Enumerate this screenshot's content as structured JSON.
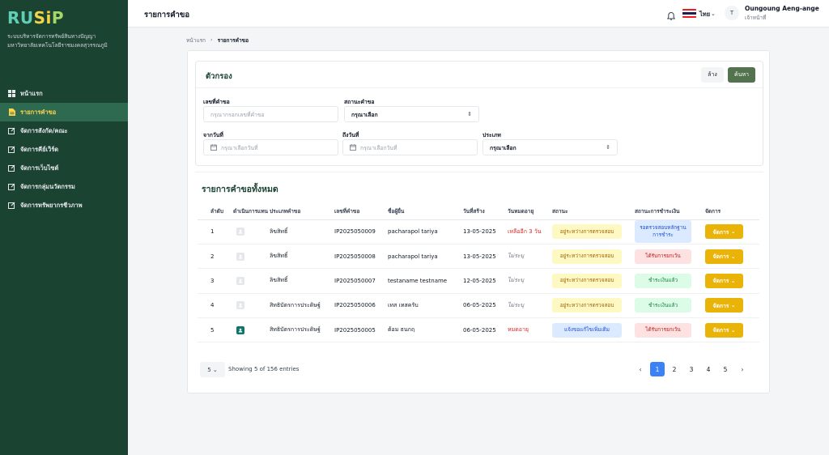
{
  "brand": {
    "logo": "RUSiP",
    "org_line1": "ระบบบริหารจัดการทรัพย์สินทางปัญญา",
    "org_line2": "มหาวิทยาลัยเทคโนโลยีราชมงคลสุวรรณภูมิ"
  },
  "sidebar": {
    "items": [
      {
        "label": "หน้าแรก",
        "icon": "grid-icon",
        "active": false
      },
      {
        "label": "รายการคำขอ",
        "icon": "document-icon",
        "active": true
      },
      {
        "label": "จัดการสังกัด/คณะ",
        "icon": "edit-icon",
        "active": false
      },
      {
        "label": "จัดการคีย์เวิร์ด",
        "icon": "edit-icon",
        "active": false
      },
      {
        "label": "จัดการเว็บไซต์",
        "icon": "edit-icon",
        "active": false
      },
      {
        "label": "จัดการกลุ่มนวัตกรรม",
        "icon": "edit-icon",
        "active": false
      },
      {
        "label": "จัดการทรัพยากรชีวภาพ",
        "icon": "edit-icon",
        "active": false
      }
    ]
  },
  "topbar": {
    "title": "รายการคำขอ",
    "lang": "ไทย",
    "avatar_initial": "T",
    "user_name": "Oungoung Aeng-ange",
    "user_role": "เจ้าหน้าที่"
  },
  "breadcrumb": {
    "home": "หน้าแรก",
    "current": "รายการคำขอ"
  },
  "filter": {
    "title": "ตัวกรอง",
    "clear_label": "ล้าง",
    "search_label": "ค้นหา",
    "request_no_label": "เลขที่คำขอ",
    "request_no_placeholder": "กรุณากรอกเลขที่คำขอ",
    "status_label": "สถานะคำขอ",
    "status_value": "กรุณาเลือก",
    "from_label": "จากวันที่",
    "from_placeholder": "กรุณาเลือกวันที่",
    "to_label": "ถึงวันที่",
    "to_placeholder": "กรุณาเลือกวันที่",
    "type_label": "ประเภท",
    "type_value": "กรุณาเลือก"
  },
  "list": {
    "title": "รายการคำขอทั้งหมด",
    "columns": [
      "ลำดับ",
      "ดำเนินการแทน",
      "ประเภทคำขอ",
      "เลขที่คำขอ",
      "ชื่อผู้ยื่น",
      "วันที่สร้าง",
      "วันหมดอายุ",
      "สถานะ",
      "สถานะการชำระเงิน",
      "จัดการ"
    ],
    "rows": [
      {
        "idx": "1",
        "type": "ลิขสิทธิ์",
        "id": "IP2025050009",
        "name": "pacharapol tariya",
        "date": "13-05-2025",
        "expiry": "เหลืออีก 3 วัน",
        "status": "อยู่ระหว่างการตรวจสอบ",
        "payment": "รอตรวจสอบหลักฐานการชำระ",
        "action": "จัดการ"
      },
      {
        "idx": "2",
        "type": "ลิขสิทธิ์",
        "id": "IP2025050008",
        "name": "pacharapol tariya",
        "date": "13-05-2025",
        "expiry": "ไม่ระบุ",
        "status": "อยู่ระหว่างการตรวจสอบ",
        "payment": "ได้รับการยกเว้น",
        "action": "จัดการ"
      },
      {
        "idx": "3",
        "type": "ลิขสิทธิ์",
        "id": "IP2025050007",
        "name": "testaname testname",
        "date": "12-05-2025",
        "expiry": "ไม่ระบุ",
        "status": "อยู่ระหว่างการตรวจสอบ",
        "payment": "ชำระเงินแล้ว",
        "action": "จัดการ"
      },
      {
        "idx": "4",
        "type": "สิทธิบัตรการประดิษฐ์",
        "id": "IP2025050006",
        "name": "เทส เทสครับ",
        "date": "06-05-2025",
        "expiry": "ไม่ระบุ",
        "status": "อยู่ระหว่างการตรวจสอบ",
        "payment": "ชำระเงินแล้ว",
        "action": "จัดการ"
      },
      {
        "idx": "5",
        "type": "สิทธิบัตรการประดิษฐ์",
        "id": "IP2025050005",
        "name": "ต้อม ธนกฤ",
        "date": "06-05-2025",
        "expiry": "หมดอายุ",
        "status": "แจ้งขอแก้ไขเพิ่มเติม",
        "payment": "ได้รับการยกเว้น",
        "action": "จัดการ"
      }
    ]
  },
  "pagination": {
    "page_size": "5",
    "showing": "Showing 5 of 156 entries",
    "prev": "‹",
    "next": "›",
    "pages": [
      "1",
      "2",
      "3",
      "4",
      "5"
    ],
    "current": "1"
  },
  "colors": {
    "sidebar_bg": "#1b4332",
    "accent": "#eab308",
    "search_btn": "#52734d",
    "page_active": "#3b82f6"
  }
}
